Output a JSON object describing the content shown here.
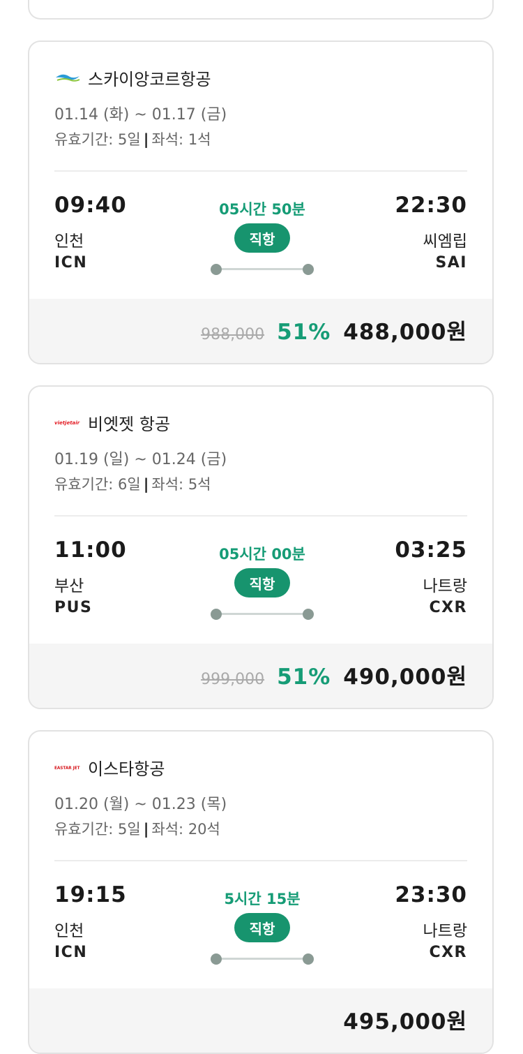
{
  "colors": {
    "accent": "#17946e",
    "accent_text": "#169c76",
    "border": "#e2e2e2",
    "price_bg": "#f5f5f5"
  },
  "flights": [
    {
      "airline": "스카이앙코르항공",
      "logo_icon": "sky-angkor-logo-icon",
      "dates": "01.14 (화) ~ 01.17 (금)",
      "validity_label": "유효기간:",
      "validity": "5일",
      "seats_label": "좌석:",
      "seats": "1석",
      "dep_time": "09:40",
      "dep_city": "인천",
      "dep_code": "ICN",
      "duration": "05시간 50분",
      "type": "직항",
      "arr_time": "22:30",
      "arr_city": "씨엠립",
      "arr_code": "SAI",
      "orig_price": "988,000",
      "discount": "51%",
      "final_price": "488,000원"
    },
    {
      "airline": "비엣젯 항공",
      "logo_icon": "vietjet-logo-icon",
      "dates": "01.19 (일) ~ 01.24 (금)",
      "validity_label": "유효기간:",
      "validity": "6일",
      "seats_label": "좌석:",
      "seats": "5석",
      "dep_time": "11:00",
      "dep_city": "부산",
      "dep_code": "PUS",
      "duration": "05시간 00분",
      "type": "직항",
      "arr_time": "03:25",
      "arr_city": "나트랑",
      "arr_code": "CXR",
      "orig_price": "999,000",
      "discount": "51%",
      "final_price": "490,000원"
    },
    {
      "airline": "이스타항공",
      "logo_icon": "eastar-jet-logo-icon",
      "dates": "01.20 (월) ~ 01.23 (목)",
      "validity_label": "유효기간:",
      "validity": "5일",
      "seats_label": "좌석:",
      "seats": "20석",
      "dep_time": "19:15",
      "dep_city": "인천",
      "dep_code": "ICN",
      "duration": "5시간 15분",
      "type": "직항",
      "arr_time": "23:30",
      "arr_city": "나트랑",
      "arr_code": "CXR",
      "orig_price": "",
      "discount": "",
      "final_price": "495,000원"
    }
  ]
}
